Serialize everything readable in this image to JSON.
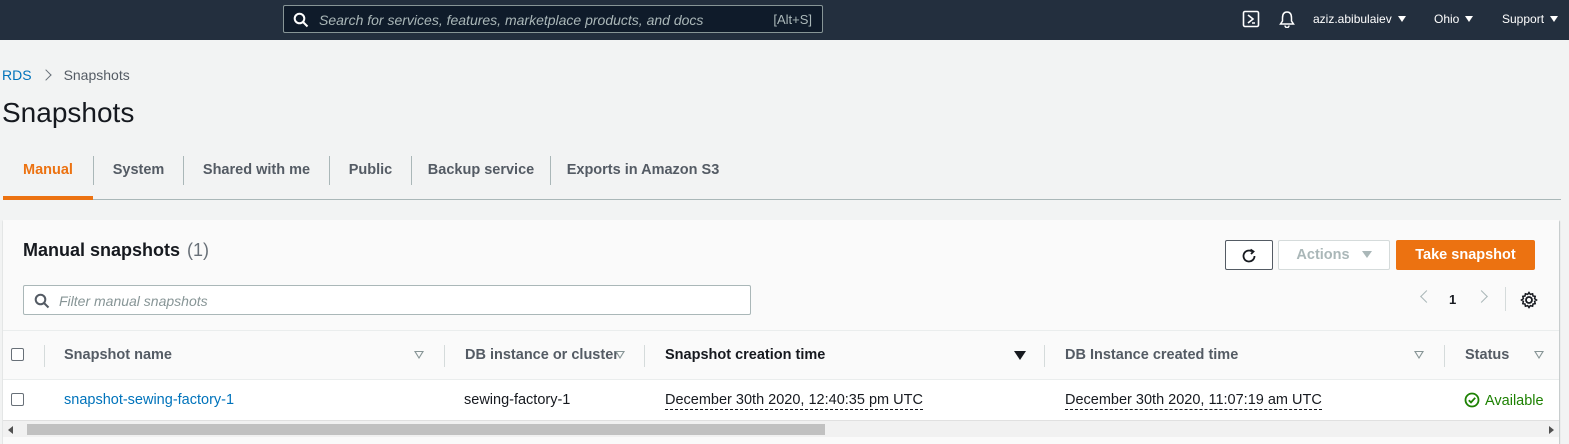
{
  "topnav": {
    "search_placeholder": "Search for services, features, marketplace products, and docs",
    "search_shortcut": "[Alt+S]",
    "user": "aziz.abibulaiev",
    "region": "Ohio",
    "support": "Support"
  },
  "breadcrumb": {
    "root": "RDS",
    "current": "Snapshots"
  },
  "page": {
    "title": "Snapshots"
  },
  "tabs": [
    {
      "label": "Manual",
      "active": true
    },
    {
      "label": "System"
    },
    {
      "label": "Shared with me"
    },
    {
      "label": "Public"
    },
    {
      "label": "Backup service"
    },
    {
      "label": "Exports in Amazon S3"
    }
  ],
  "panel": {
    "title": "Manual snapshots",
    "count": "(1)",
    "actions_label": "Actions",
    "take_snapshot_label": "Take snapshot",
    "filter_placeholder": "Filter manual snapshots",
    "page_number": "1"
  },
  "table": {
    "columns": [
      "Snapshot name",
      "DB instance or cluster",
      "Snapshot creation time",
      "DB Instance created time",
      "Status"
    ],
    "sorted_column": "Snapshot creation time",
    "rows": [
      {
        "snapshot_name": "snapshot-sewing-factory-1",
        "db_instance": "sewing-factory-1",
        "snapshot_creation_time": "December 30th 2020, 12:40:35 pm UTC",
        "instance_created_time": "December 30th 2020, 11:07:19 am UTC",
        "status": "Available"
      }
    ]
  },
  "colors": {
    "nav_bg": "#232f3e",
    "accent": "#ec7211",
    "link": "#0073bb",
    "success": "#1d8102"
  }
}
